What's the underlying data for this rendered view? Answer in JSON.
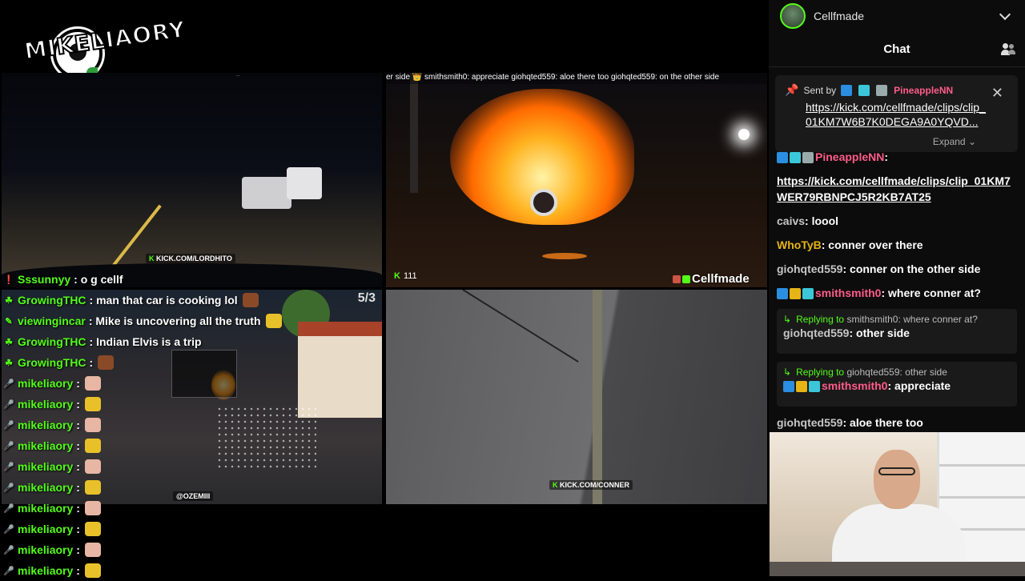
{
  "stream": {
    "logo_text": "MIKELIAORY",
    "ticker": "er side 👑 smithsmith0: appreciate giohqted559: aloe there too giohqted559: on the other side",
    "ticker_tl": "...",
    "watermarks": {
      "tl": "KICK.COM/LORDHITO",
      "bl": "@OZEMIII",
      "br": "KICK.COM/CONNER"
    },
    "counter": "5/3",
    "viewer_count": "111",
    "streamer_tag": "Cellfmade"
  },
  "overlay_chat": [
    {
      "icon": "alert",
      "user": "Sssunnyy",
      "text": ": o g cellf",
      "emote": ""
    },
    {
      "icon": "leaf",
      "user": "GrowingTHC",
      "text": ": man that car is cooking lol",
      "emote": "brown"
    },
    {
      "icon": "pencil",
      "user": "viewingincar",
      "text": ": Mike is uncovering all the truth",
      "emote": "laugh"
    },
    {
      "icon": "leaf",
      "user": "GrowingTHC",
      "text": ": Indian Elvis is a trip",
      "emote": ""
    },
    {
      "icon": "leaf",
      "user": "GrowingTHC",
      "text": ":",
      "emote": "brown"
    },
    {
      "icon": "mic",
      "user": "mikeliaory",
      "text": ":",
      "emote": "face"
    },
    {
      "icon": "mic",
      "user": "mikeliaory",
      "text": ":",
      "emote": "hands"
    },
    {
      "icon": "mic",
      "user": "mikeliaory",
      "text": ":",
      "emote": "face"
    },
    {
      "icon": "mic",
      "user": "mikeliaory",
      "text": ":",
      "emote": "hands"
    },
    {
      "icon": "mic",
      "user": "mikeliaory",
      "text": ":",
      "emote": "face"
    },
    {
      "icon": "mic",
      "user": "mikeliaory",
      "text": ":",
      "emote": "hands"
    },
    {
      "icon": "mic",
      "user": "mikeliaory",
      "text": ":",
      "emote": "face"
    },
    {
      "icon": "mic",
      "user": "mikeliaory",
      "text": ":",
      "emote": "hands"
    },
    {
      "icon": "mic",
      "user": "mikeliaory",
      "text": ":",
      "emote": "face"
    },
    {
      "icon": "mic",
      "user": "mikeliaory",
      "text": ":",
      "emote": "hands"
    }
  ],
  "panel": {
    "channel_name": "Cellfmade",
    "chat_title": "Chat",
    "pinned": {
      "sent_by": "Sent by",
      "user": "PineappleNN",
      "link": "https://kick.com/cellfmade/clips/clip_01KM7W6B7K0DEGA9A0YQVD...",
      "expand": "Expand"
    },
    "messages": [
      {
        "type": "msg",
        "user": "PineappleNN",
        "user_color": "#ff5c8a",
        "text": "",
        "badges": [
          "blue",
          "cyan",
          "gray"
        ]
      },
      {
        "type": "link",
        "text": "https://kick.com/cellfmade/clips/clip_01KM7WER79RBNPCJ5R2KB7AT25"
      },
      {
        "type": "msg",
        "user": "caivs",
        "user_color": "#c6c6c6",
        "text": "loool",
        "badges": []
      },
      {
        "type": "msg",
        "user": "WhoTyB",
        "user_color": "#e5b416",
        "text": "conner over there",
        "badges": []
      },
      {
        "type": "msg",
        "user": "giohqted559",
        "user_color": "#c6c6c6",
        "text": "conner on the other side",
        "badges": []
      },
      {
        "type": "msg",
        "user": "smithsmith0",
        "user_color": "#ff5c8a",
        "text": "where conner at?",
        "badges": [
          "blue",
          "gold",
          "cyan"
        ]
      },
      {
        "type": "reply",
        "reply_label": "Replying to",
        "reply_user": "smithsmith0",
        "reply_text": "where conner at?",
        "user": "giohqted559",
        "user_color": "#c6c6c6",
        "text": "other side",
        "badges": []
      },
      {
        "type": "reply",
        "reply_label": "Replying to",
        "reply_user": "giohqted559",
        "reply_text": "other side",
        "user": "smithsmith0",
        "user_color": "#ff5c8a",
        "text": "appreciate",
        "badges": [
          "blue",
          "gold",
          "cyan"
        ]
      },
      {
        "type": "msg",
        "user": "giohqted559",
        "user_color": "#c6c6c6",
        "text": "aloe there too",
        "badges": []
      }
    ]
  },
  "colors": {
    "kick_green": "#53fc18",
    "panel_bg": "#0c0c0c"
  }
}
